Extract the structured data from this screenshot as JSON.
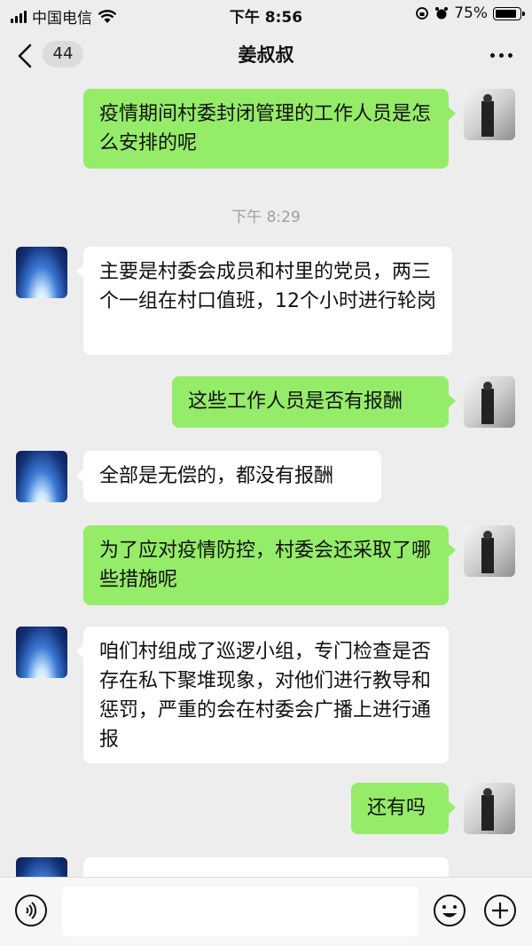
{
  "status_bar": {
    "carrier": "中国电信",
    "time": "下午 8:56",
    "battery": "75%"
  },
  "nav": {
    "unread_count": "44",
    "title": "姜叔叔"
  },
  "messages": [
    {
      "from": "self",
      "text": "疫情期间村委封闭管理的工作人员是怎么安排的呢"
    },
    {
      "type": "timestamp",
      "text": "下午 8:29"
    },
    {
      "from": "other",
      "text": "主要是村委会成员和村里的党员，两三个一组在村口值班，12个小时进行轮岗"
    },
    {
      "from": "self",
      "text": "这些工作人员是否有报酬"
    },
    {
      "from": "other",
      "text": "全部是无偿的，都没有报酬"
    },
    {
      "from": "self",
      "text": "为了应对疫情防控，村委会还采取了哪些措施呢"
    },
    {
      "from": "other",
      "text": "咱们村组成了巡逻小组，专门检查是否存在私下聚堆现象，对他们进行教导和惩罚，严重的会在村委会广播上进行通报"
    },
    {
      "from": "self",
      "text": "还有吗"
    },
    {
      "from": "other",
      "text": "……"
    }
  ],
  "input": {
    "value": ""
  },
  "colors": {
    "self_bubble": "#95ec69",
    "other_bubble": "#ffffff",
    "background": "#ededed"
  }
}
